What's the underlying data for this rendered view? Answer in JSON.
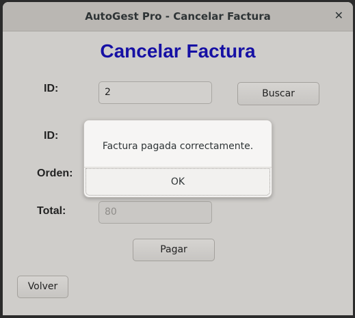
{
  "window": {
    "title": "AutoGest Pro - Cancelar Factura",
    "close_glyph": "✕"
  },
  "heading": "Cancelar Factura",
  "form": {
    "search_id_label": "ID:",
    "search_id_value": "2",
    "search_button": "Buscar",
    "id_label": "ID:",
    "order_label": "Orden:",
    "total_label": "Total:",
    "total_value": "80",
    "pay_button": "Pagar",
    "back_button": "Volver"
  },
  "dialog": {
    "message": "Factura pagada correctamente.",
    "ok_button": "OK"
  },
  "colors": {
    "heading": "#1610a4",
    "window_bg": "#cfcdca",
    "titlebar_bg": "#bab7b3"
  },
  "icons": {
    "close": "close-icon"
  }
}
